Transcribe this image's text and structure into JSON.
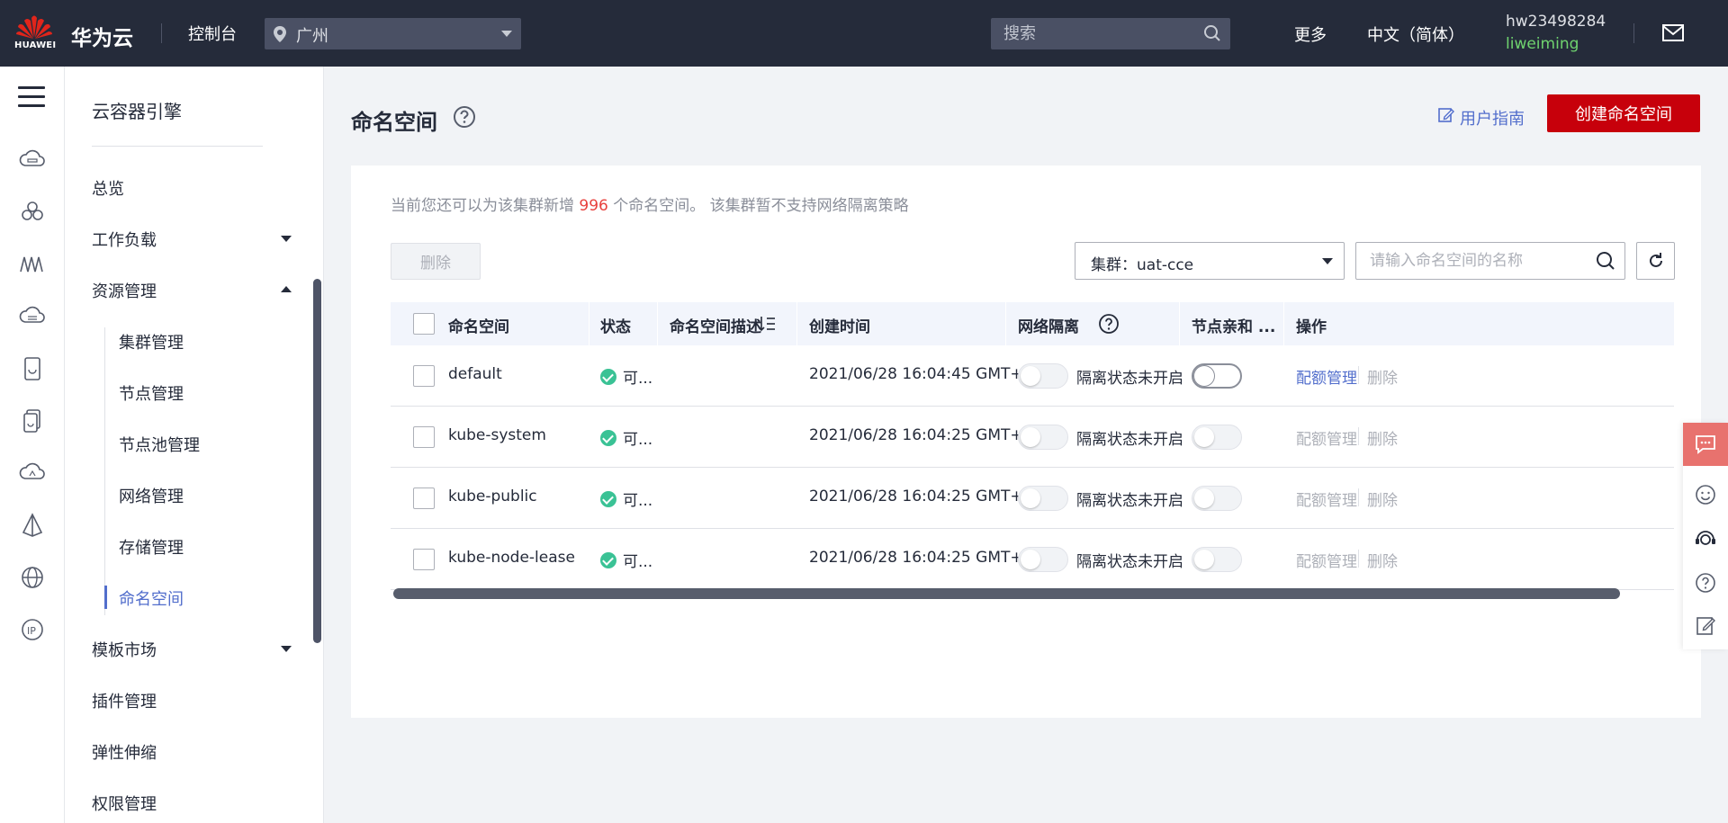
{
  "topbar": {
    "logo_text": "HUAWEI",
    "brand": "华为云",
    "console": "控制台",
    "region": "广州",
    "search_placeholder": "搜索",
    "more": "更多",
    "language": "中文（简体）",
    "account": "hw23498284",
    "username": "liweiming"
  },
  "sidebar": {
    "title": "云容器引擎",
    "items": [
      {
        "label": "总览"
      },
      {
        "label": "工作负载"
      },
      {
        "label": "资源管理"
      },
      {
        "label": "模板市场"
      },
      {
        "label": "插件管理"
      },
      {
        "label": "弹性伸缩"
      },
      {
        "label": "权限管理"
      }
    ],
    "sub_items": [
      {
        "label": "集群管理"
      },
      {
        "label": "节点管理"
      },
      {
        "label": "节点池管理"
      },
      {
        "label": "网络管理"
      },
      {
        "label": "存储管理"
      },
      {
        "label": "命名空间"
      }
    ]
  },
  "page": {
    "title": "命名空间",
    "user_guide": "用户指南",
    "create_button": "创建命名空间"
  },
  "notice": {
    "prefix": "当前您还可以为该集群新增 ",
    "count": "996",
    "suffix": " 个命名空间。 该集群暂不支持网络隔离策略"
  },
  "toolbar": {
    "delete_button": "删除",
    "cluster_select": "集群：uat-cce",
    "search_placeholder": "请输入命名空间的名称"
  },
  "table": {
    "columns": [
      "命名空间",
      "状态",
      "命名空间描述",
      "创建时间",
      "网络隔离",
      "节点亲和 ...",
      "操作"
    ],
    "rows": [
      {
        "name": "default",
        "status": "可...",
        "description": "",
        "created": "2021/06/28 16:04:45 GMT+0...",
        "isolation": "隔离状态未开启",
        "quota": "配额管理",
        "delete": "删除"
      },
      {
        "name": "kube-system",
        "status": "可...",
        "description": "",
        "created": "2021/06/28 16:04:25 GMT+0...",
        "isolation": "隔离状态未开启",
        "quota": "配额管理",
        "delete": "删除"
      },
      {
        "name": "kube-public",
        "status": "可...",
        "description": "",
        "created": "2021/06/28 16:04:25 GMT+0...",
        "isolation": "隔离状态未开启",
        "quota": "配额管理",
        "delete": "删除"
      },
      {
        "name": "kube-node-lease",
        "status": "可...",
        "description": "",
        "created": "2021/06/28 16:04:25 GMT+0...",
        "isolation": "隔离状态未开启",
        "quota": "配额管理",
        "delete": "删除"
      }
    ]
  },
  "colors": {
    "brand_red": "#c7000b",
    "link_blue": "#526ecc",
    "status_green": "#3ac295",
    "topbar_bg": "#252b3a"
  }
}
